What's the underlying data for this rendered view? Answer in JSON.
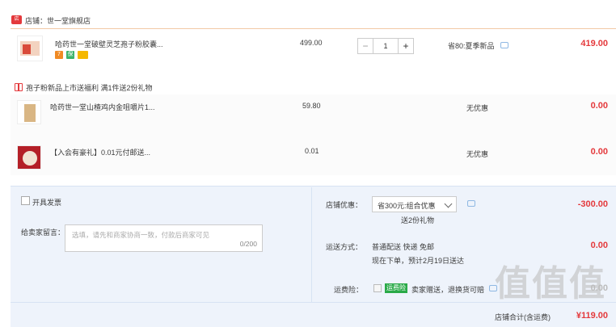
{
  "store": {
    "name": "店铺：世一堂旗舰店",
    "icon": "store-icon"
  },
  "items": [
    {
      "title": "哈药世一堂破壁灵芝孢子粉胶囊...",
      "price": "499.00",
      "quantity": "1",
      "promo": "省80:夏季新品",
      "total": "419.00"
    },
    {
      "title": "哈药世一堂山楂鸡内金咀嚼片1...",
      "price": "59.80",
      "promo": "无优惠",
      "total": "0.00"
    },
    {
      "title": "【入会有豪礼】0.01元付邮送...",
      "price": "0.01",
      "promo": "无优惠",
      "total": "0.00"
    }
  ],
  "gift": {
    "text": "孢子粉新品上市送福利    满1件送2份礼物"
  },
  "invoice": {
    "label": "开具发票"
  },
  "note": {
    "label": "给卖家留言：",
    "placeholder": "选填，请先和商家协商一致，付款后商家可见",
    "count": "0/200"
  },
  "store_discount": {
    "label": "店铺优惠：",
    "selected": "省300元:组合优惠",
    "sub": "送2份礼物",
    "value": "-300.00"
  },
  "shipping": {
    "label": "运送方式：",
    "method": "普通配送 快递 免邮",
    "eta": "现在下单，预计2月19日送达",
    "value": "0.00"
  },
  "insurance": {
    "label": "运费险：",
    "tag": "运费险",
    "text": "卖家赠送，退换货可赔",
    "value": "0.00"
  },
  "summary": {
    "label": "店铺合计(含运费)",
    "value": "¥119.00"
  },
  "watermark": "值值值",
  "colors": {
    "accent_red": "#e4393c",
    "panel_blue": "#eef3fb",
    "green": "#2aaa48"
  }
}
